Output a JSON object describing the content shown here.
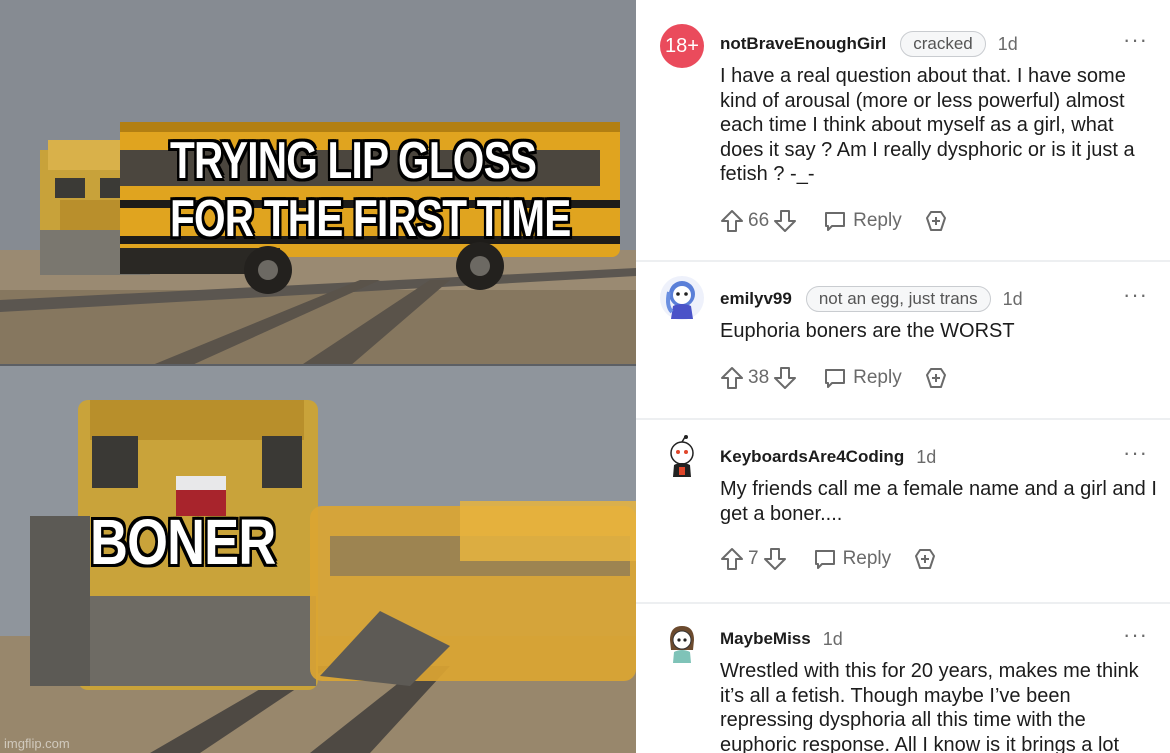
{
  "meme": {
    "top_caption_line1": "TRYING LIP GLOSS",
    "top_caption_line2": "FOR THE FIRST TIME",
    "bottom_caption": "BONER",
    "watermark": "imgflip.com"
  },
  "comments": [
    {
      "avatar_text": "18+",
      "username": "notBraveEnoughGirl",
      "flair": "cracked",
      "age": "1d",
      "more": "···",
      "body": "I have a real question about that. I have some kind of arousal (more or less powerful) almost each time I think about myself as a girl, what does it say ? Am I really dysphoric or is it just a fetish ? -_-",
      "votes": "66",
      "reply_label": "Reply"
    },
    {
      "username": "emilyv99",
      "flair": "not an egg, just trans",
      "age": "1d",
      "more": "···",
      "body": "Euphoria boners are the WORST",
      "votes": "38",
      "reply_label": "Reply"
    },
    {
      "username": "KeyboardsAre4Coding",
      "age": "1d",
      "more": "···",
      "body": "My friends call me a female name and a girl and I get a boner....",
      "votes": "7",
      "reply_label": "Reply"
    },
    {
      "username": "MaybeMiss",
      "age": "1d",
      "more": "···",
      "body": "Wrestled with this for 20 years, makes me think it’s all a fetish. Though maybe I’ve been repressing dysphoria all this time with the euphoric response. All I know is it brings a lot"
    }
  ],
  "colors": {
    "nsfw_avatar": "#ea4b5c",
    "text_primary": "#1c1c1c",
    "text_secondary": "#6a6a6a",
    "separator": "#edeff1"
  }
}
